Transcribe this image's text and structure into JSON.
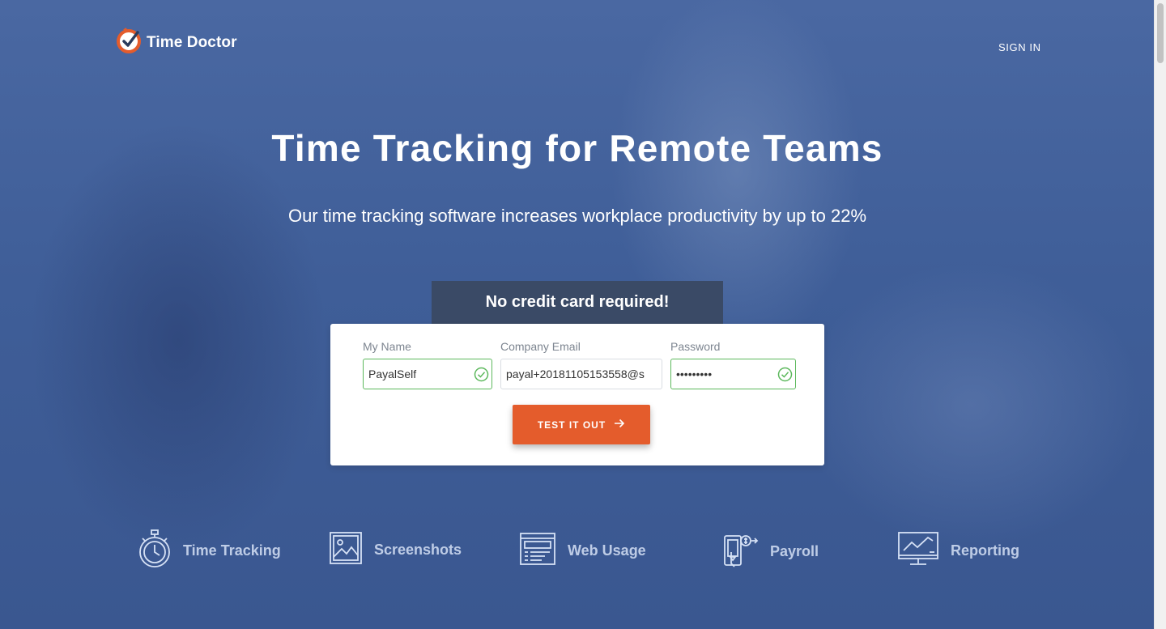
{
  "brand": {
    "name": "Time Doctor",
    "accent": "#e45c2c"
  },
  "nav": {
    "sign_in": "SIGN IN"
  },
  "hero": {
    "title": "Time Tracking for Remote Teams",
    "subtitle": "Our time tracking software increases workplace productivity by up to 22%"
  },
  "signup": {
    "banner": "No credit card required!",
    "name": {
      "label": "My Name",
      "value": "PayalSelf"
    },
    "email": {
      "label": "Company Email",
      "value": "payal+20181105153558@s"
    },
    "password": {
      "label": "Password",
      "value": "•••••••••"
    },
    "submit_label": "TEST IT OUT",
    "submit_icon": "arrow-right-icon"
  },
  "features": [
    {
      "label": "Time Tracking",
      "icon": "stopwatch-icon"
    },
    {
      "label": "Screenshots",
      "icon": "image-icon"
    },
    {
      "label": "Web Usage",
      "icon": "browser-icon"
    },
    {
      "label": "Payroll",
      "icon": "payroll-icon"
    },
    {
      "label": "Reporting",
      "icon": "chart-icon"
    }
  ]
}
